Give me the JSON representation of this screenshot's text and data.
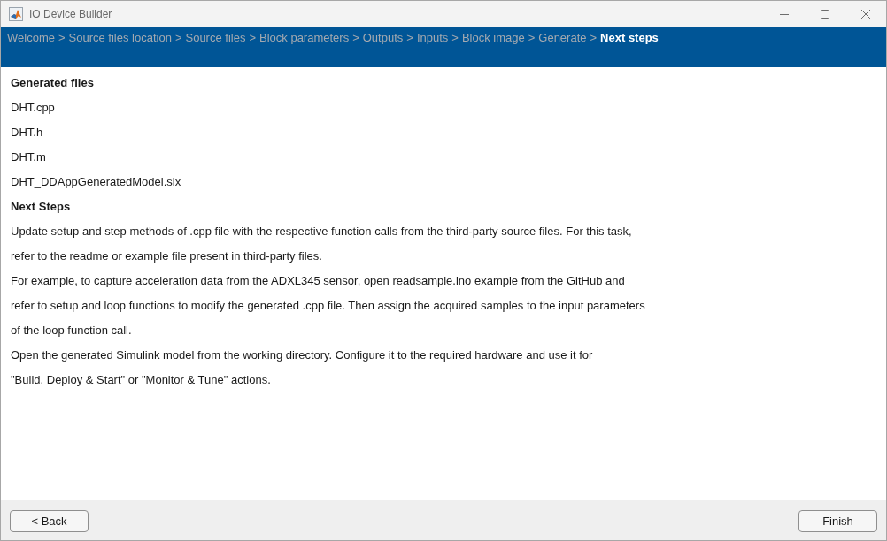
{
  "window": {
    "title": "IO Device Builder"
  },
  "breadcrumb": [
    {
      "label": "Welcome",
      "separator": ">",
      "selected": false
    },
    {
      "label": "Source files location",
      "separator": ">",
      "selected": false
    },
    {
      "label": "Source files",
      "separator": ">",
      "selected": false
    },
    {
      "label": "Block parameters",
      "separator": ">",
      "selected": false
    },
    {
      "label": "Outputs",
      "separator": ">",
      "selected": false
    },
    {
      "label": "Inputs",
      "separator": ">",
      "selected": false
    },
    {
      "label": "Block image",
      "separator": ">",
      "selected": false
    },
    {
      "label": "Generate",
      "separator": ">",
      "selected": false
    },
    {
      "label": "Next steps",
      "selected": true
    }
  ],
  "generated_files": {
    "heading": "Generated files",
    "files": [
      "DHT.cpp",
      "DHT.h",
      "DHT.m",
      "DHT_DDAppGeneratedModel.slx"
    ]
  },
  "next_steps": {
    "heading": "Next Steps",
    "lines": [
      "Update setup and step methods of .cpp file with the respective function calls from the third-party source files. For this task,",
      "refer to the readme or example file present in third-party files.",
      "For example, to capture acceleration data from the ADXL345 sensor, open readsample.ino example from the GitHub and",
      "refer to setup and loop functions to modify the generated .cpp file. Then assign the acquired samples to the input parameters",
      "of the loop function call.",
      "Open the generated Simulink model from the working directory. Configure it to the required hardware and use it for",
      "\"Build, Deploy & Start\" or \"Monitor & Tune\" actions."
    ]
  },
  "footer": {
    "back_button": "< Back",
    "finish_button": "Finish"
  }
}
